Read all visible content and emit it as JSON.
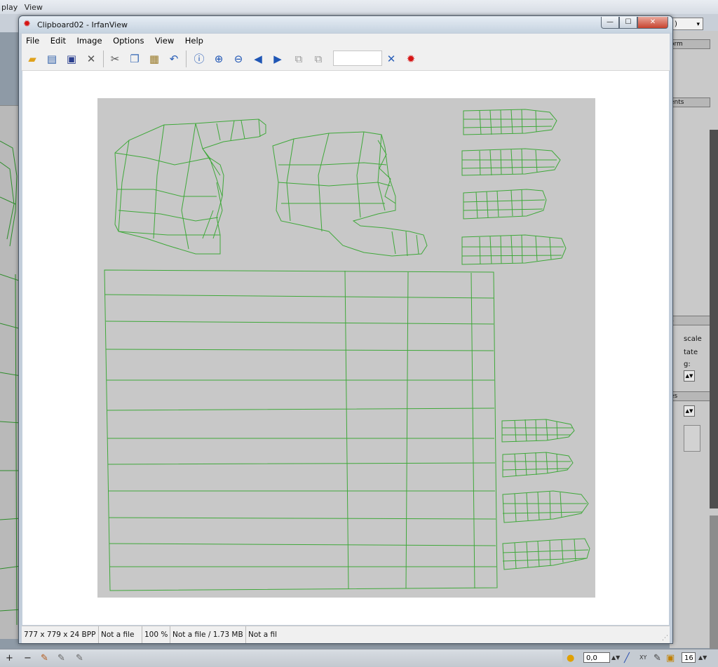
{
  "background_app": {
    "menu": [
      "play",
      "View"
    ],
    "right_panel": {
      "combo_dropdown": "▾",
      "combo_value": ")",
      "headers": [
        "orm",
        "ents",
        "s",
        "es"
      ],
      "labels": [
        "scale",
        "tate",
        "g:"
      ]
    },
    "bottom_bar": {
      "coord_field": "0,0",
      "axis_label": "XY",
      "frame_field": "16"
    }
  },
  "window": {
    "title": "Clipboard02 - IrfanView",
    "buttons": {
      "minimize": "—",
      "maximize": "☐",
      "close": "✕"
    },
    "menu": [
      "File",
      "Edit",
      "Image",
      "Options",
      "View",
      "Help"
    ],
    "toolbar_icons": [
      "open-folder-icon",
      "slideshow-icon",
      "save-icon",
      "delete-icon",
      "cut-icon",
      "copy-icon",
      "paste-icon",
      "undo-icon",
      "info-icon",
      "zoom-in-icon",
      "zoom-out-icon",
      "previous-icon",
      "next-icon",
      "first-page-icon",
      "next-page-icon",
      "settings-icon",
      "irfanview-logo-icon"
    ],
    "toolbar_input_value": "",
    "status": [
      "777 x 779 x 24 BPP",
      "Not a file",
      "100 %",
      "Not a file / 1.73 MB",
      "Not a fil"
    ]
  },
  "colors": {
    "wire": "#3fa83a",
    "canvas": "#c8c8c8",
    "title_gradient_top": "#e6edf5",
    "close_button": "#c7432f"
  }
}
